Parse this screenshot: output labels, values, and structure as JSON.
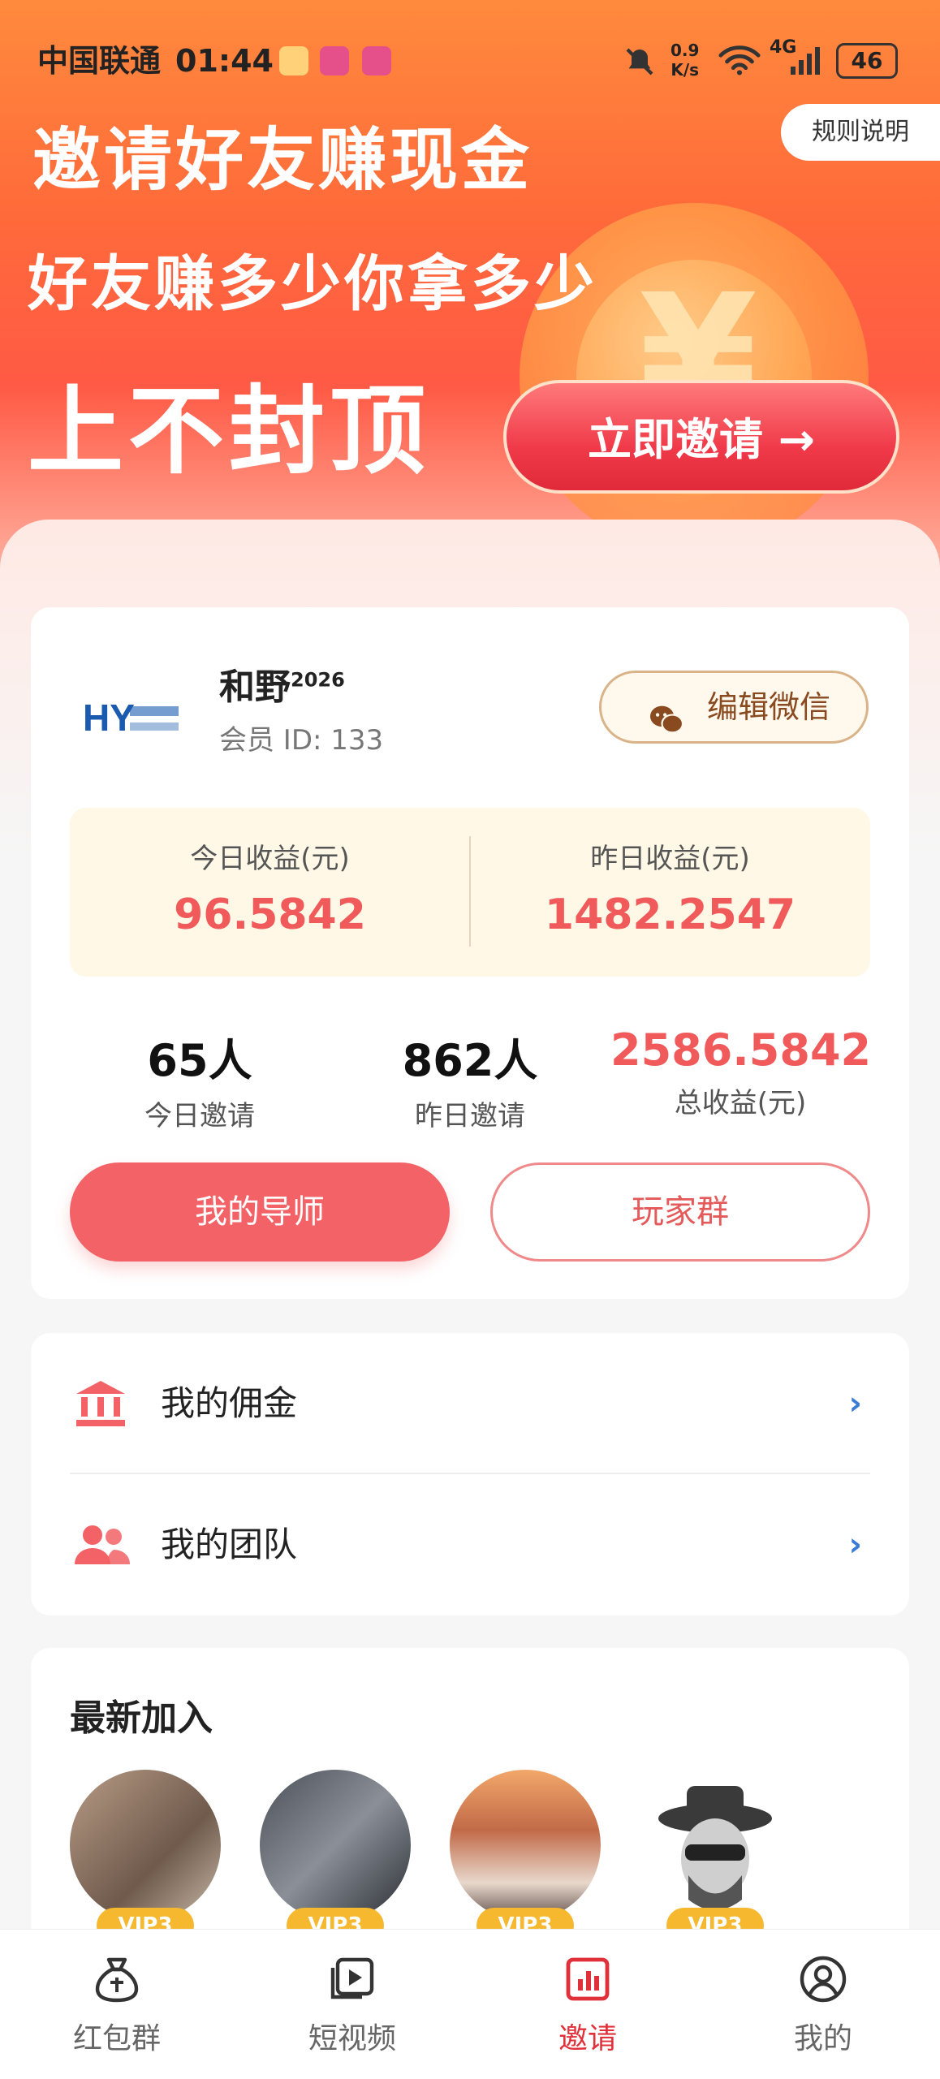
{
  "status_bar": {
    "carrier": "中国联通",
    "time": "01:44",
    "net_speed_value": "0.9",
    "net_speed_unit": "K/s",
    "signal": "4G",
    "battery": "46"
  },
  "banner": {
    "rules_button": "规则说明",
    "headline_1": "邀请好友赚现金",
    "headline_2": "好友赚多少你拿多少",
    "headline_3": "上不封顶",
    "invite_button": "立即邀请 →",
    "coin_symbol": "¥"
  },
  "profile": {
    "name": "和野",
    "name_superscript": "2026",
    "member_id": "会员 ID: 133",
    "avatar_text": "HY",
    "edit_wechat_button": "编辑微信"
  },
  "earnings": {
    "today_label": "今日收益(元)",
    "today_value": "96.5842",
    "yesterday_label": "昨日收益(元)",
    "yesterday_value": "1482.2547"
  },
  "stats": [
    {
      "value": "65人",
      "label": "今日邀请"
    },
    {
      "value": "862人",
      "label": "昨日邀请"
    },
    {
      "value": "2586.5842",
      "label": "总收益(元)"
    }
  ],
  "actions": {
    "mentor_button": "我的导师",
    "group_button": "玩家群"
  },
  "menu": [
    {
      "label": "我的佣金",
      "icon": "bank-icon"
    },
    {
      "label": "我的团队",
      "icon": "team-icon"
    }
  ],
  "new_members": {
    "title": "最新加入",
    "badge": "VIP3"
  },
  "tabbar": [
    {
      "label": "红包群",
      "icon": "money-bag-icon",
      "active": false
    },
    {
      "label": "短视频",
      "icon": "video-icon",
      "active": false
    },
    {
      "label": "邀请",
      "icon": "chart-icon",
      "active": true
    },
    {
      "label": "我的",
      "icon": "user-icon",
      "active": false
    }
  ],
  "colors": {
    "accent": "#f26266",
    "highlight_red": "#f05a5a",
    "active_tab": "#e0303a",
    "vip_gold": "#f5b82e"
  }
}
